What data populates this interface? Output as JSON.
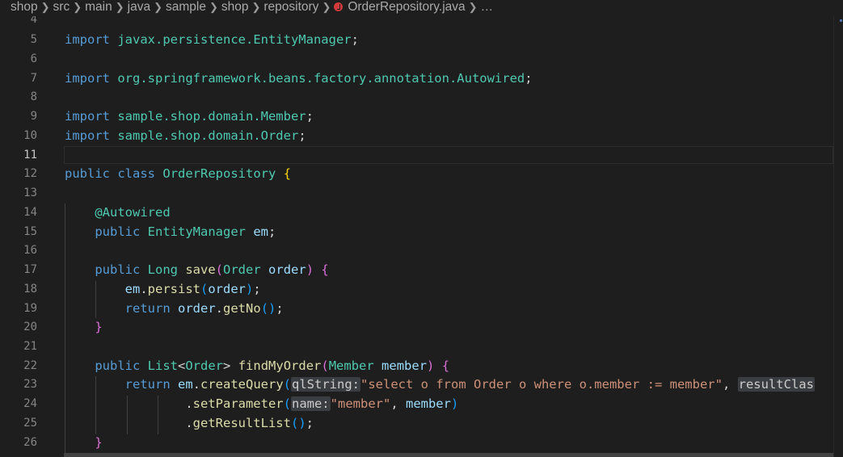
{
  "breadcrumb": {
    "parts": [
      "shop",
      "src",
      "main",
      "java",
      "sample",
      "shop",
      "repository"
    ],
    "file": "OrderRepository.java",
    "ellipsis": "…"
  },
  "line_numbers": [
    "4",
    "5",
    "6",
    "7",
    "8",
    "9",
    "10",
    "11",
    "12",
    "13",
    "14",
    "15",
    "16",
    "17",
    "18",
    "19",
    "20",
    "21",
    "22",
    "23",
    "24",
    "25",
    "26"
  ],
  "active_line": "11",
  "code": {
    "l5_kw": "import",
    "l5_pkg": "javax.persistence.EntityManager",
    "l7_kw": "import",
    "l7_pkg": "org.springframework.beans.factory.annotation.Autowired",
    "l9_kw": "import",
    "l9_pkg": "sample.shop.domain.Member",
    "l10_kw": "import",
    "l10_pkg": "sample.shop.domain.Order",
    "l12_public": "public",
    "l12_class": "class",
    "l12_name": "OrderRepository",
    "l14_annotation": "@Autowired",
    "l15_public": "public",
    "l15_type": "EntityManager",
    "l15_var": "em",
    "l17_public": "public",
    "l17_type": "Long",
    "l17_method": "save",
    "l17_ptype": "Order",
    "l17_pname": "order",
    "l18_obj": "em",
    "l18_method": "persist",
    "l18_arg": "order",
    "l19_return": "return",
    "l19_obj": "order",
    "l19_method": "getNo",
    "l22_public": "public",
    "l22_type": "List",
    "l22_generic": "Order",
    "l22_method": "findMyOrder",
    "l22_ptype": "Member",
    "l22_pname": "member",
    "l23_return": "return",
    "l23_obj": "em",
    "l23_method": "createQuery",
    "l23_hint1": "qlString:",
    "l23_string": "\"select o from Order o where o.member := member\"",
    "l23_hint2": "resultClas",
    "l24_method": "setParameter",
    "l24_hint": "name:",
    "l24_string": "\"member\"",
    "l24_arg": "member",
    "l25_method": "getResultList"
  }
}
